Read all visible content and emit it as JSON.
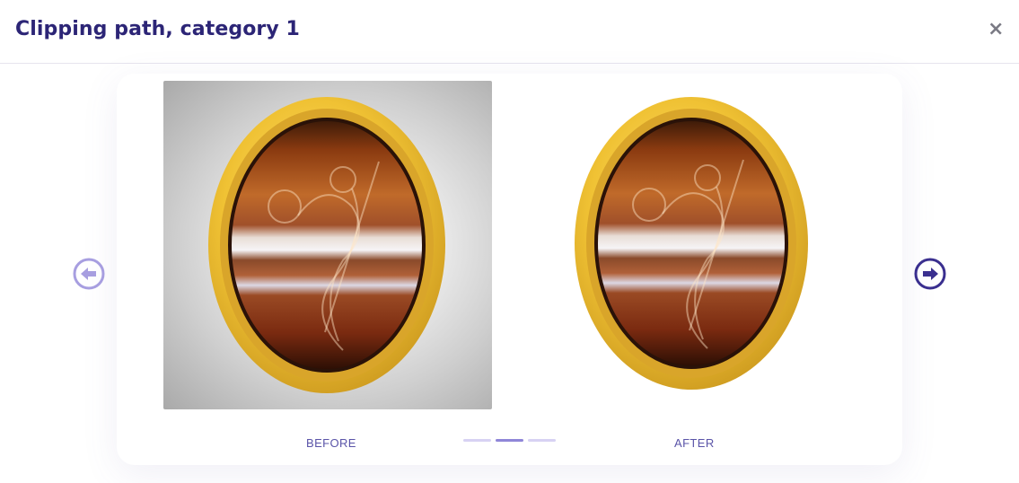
{
  "modal": {
    "title": "Clipping path, category 1"
  },
  "close_icon": "close-icon",
  "comparison": {
    "before_label": "BEFORE",
    "after_label": "AFTER"
  },
  "navigation": {
    "prev_icon": "arrow-left-circle-icon",
    "next_icon": "arrow-right-circle-icon"
  },
  "pagination": {
    "total": 3,
    "active_index": 1
  },
  "colors": {
    "title": "#2c2576",
    "accent": "#3a2f8f",
    "muted_accent": "#a79ee0",
    "caption": "#5a54a8",
    "dot": "#d7d2f3",
    "dot_active": "#8f86d8"
  }
}
